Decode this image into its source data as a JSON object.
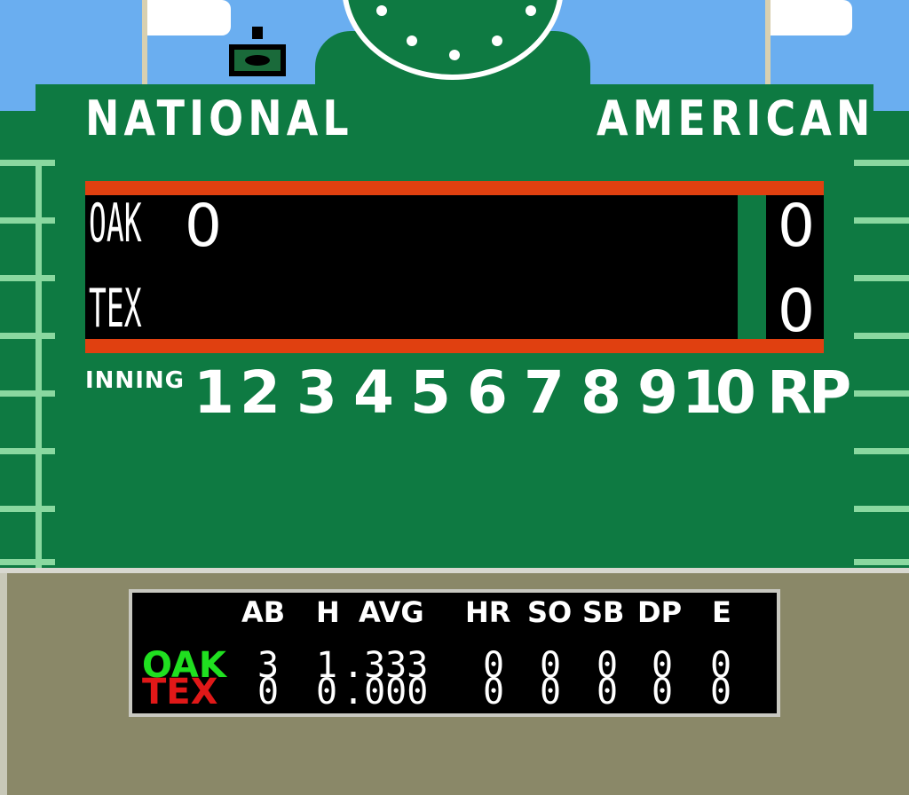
{
  "board": {
    "left_league": "NATIONAL",
    "right_league": "AMERICAN"
  },
  "linescore": {
    "teams": [
      {
        "abbr": "OAK",
        "first_inning": "0",
        "rp": "0"
      },
      {
        "abbr": "TEX",
        "first_inning": "",
        "rp": "0"
      }
    ]
  },
  "innings": {
    "label": "INNING",
    "numbers": [
      "1",
      "2",
      "3",
      "4",
      "5",
      "6",
      "7",
      "8",
      "9",
      "10"
    ],
    "rp_label": "RP"
  },
  "stats": {
    "headers": [
      "AB",
      "H",
      "AVG",
      "HR",
      "SO",
      "SB",
      "DP",
      "E"
    ],
    "rows": [
      {
        "team": "OAK",
        "color": "#20e020",
        "values": [
          "3",
          "1",
          ".333",
          "0",
          "0",
          "0",
          "0",
          "0"
        ]
      },
      {
        "team": "TEX",
        "color": "#e01818",
        "values": [
          "0",
          "0",
          ".000",
          "0",
          "0",
          "0",
          "0",
          "0"
        ]
      }
    ]
  },
  "colors": {
    "board_green": "#0e7a42",
    "screen_border": "#e04010",
    "sky": "#6aaef0",
    "panel": "#8a8868"
  }
}
